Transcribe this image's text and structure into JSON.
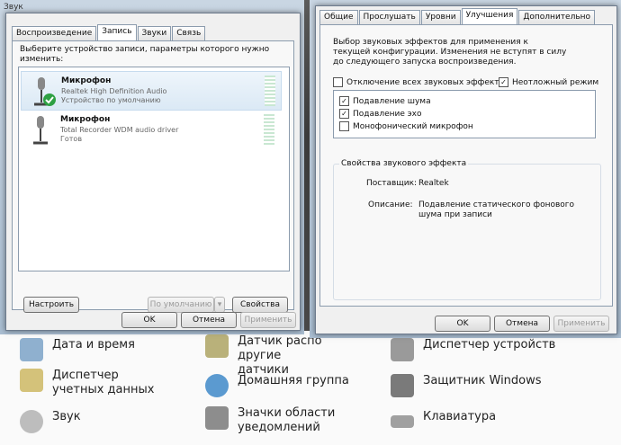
{
  "sound_window": {
    "title": "Звук",
    "tabs": [
      "Воспроизведение",
      "Запись",
      "Звуки",
      "Связь"
    ],
    "instruction": "Выберите устройство записи, параметры которого нужно изменить:",
    "devices": [
      {
        "name": "Микрофон",
        "driver": "Realtek High Definition Audio",
        "status": "Устройство по умолчанию"
      },
      {
        "name": "Микрофон",
        "driver": "Total Recorder WDM audio driver",
        "status": "Готов"
      }
    ],
    "configure_label": "Настроить",
    "default_label": "По умолчанию",
    "properties_label": "Свойства",
    "ok_label": "OK",
    "cancel_label": "Отмена",
    "apply_label": "Применить"
  },
  "props_window": {
    "tabs": [
      "Общие",
      "Прослушать",
      "Уровни",
      "Улучшения",
      "Дополнительно"
    ],
    "description": "Выбор звуковых эффектов для применения к текущей конфигурации. Изменения не вступят в силу до следующего запуска воспроизведения.",
    "disable_all_label": "Отключение всех звуковых эффектов",
    "immediate_label": "Неотложный режим",
    "effects": [
      {
        "label": "Подавление шума",
        "checked": true
      },
      {
        "label": "Подавление эхо",
        "checked": true
      },
      {
        "label": "Монофонический микрофон",
        "checked": false
      }
    ],
    "group_title": "Свойства звукового эффекта",
    "provider_label": "Поставщик:",
    "provider_value": "Realtek",
    "desc_label": "Описание:",
    "desc_value": "Подавление статического фонового шума при записи",
    "ok_label": "OK",
    "cancel_label": "Отмена",
    "apply_label": "Применить"
  },
  "control_panel": [
    {
      "label": "Дата и время",
      "icon": "clock-icon"
    },
    {
      "label": "Датчик распо другие датчики",
      "icon": "sensor-icon"
    },
    {
      "label": "Диспетчер устройств",
      "icon": "device-manager-icon"
    },
    {
      "label": "Диспетчер учетных данных",
      "icon": "credentials-icon"
    },
    {
      "label": "Домашняя группа",
      "icon": "homegroup-icon"
    },
    {
      "label": "Защитник Windows",
      "icon": "defender-icon"
    },
    {
      "label": "Звук",
      "icon": "speaker-icon"
    },
    {
      "label": "Значки области уведомлений",
      "icon": "notification-icon"
    },
    {
      "label": "Клавиатура",
      "icon": "keyboard-icon"
    }
  ],
  "colors": {
    "accent": "#3c7fb1",
    "selection": "#dbe9f5",
    "check": "#2ea043"
  }
}
